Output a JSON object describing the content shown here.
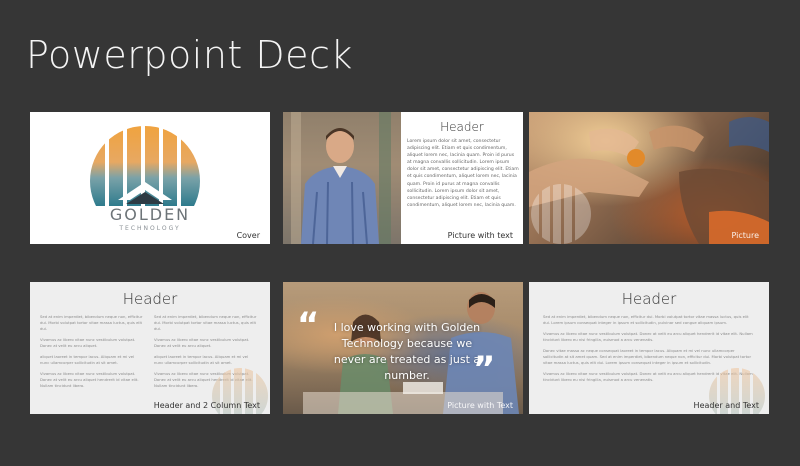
{
  "page_title": "Powerpoint Deck",
  "slides": [
    {
      "caption": "Cover",
      "brand_name": "GOLDEN",
      "brand_sub": "TECHNOLOGY"
    },
    {
      "caption": "Picture with text",
      "header": "Header",
      "body": "Lorem ipsum dolor sit amet, consectetur adipiscing elit. Etiam et quis condimentum, aliquet lorem nec, lacinia quam. Proin id purus at magna convallis sollicitudin. Lorem ipsum dolor sit amet, consectetur adipiscing elit. Etiam et quis condimentum, aliquet lorem nec, lacinia quam. Proin id purus at magna convallis sollicitudin. Lorem ipsum dolor sit amet, consectetur adipiscing elit. Etiam et quis condimentum, aliquet lorem nec, lacinia quam."
    },
    {
      "caption": "Picture"
    },
    {
      "caption": "Header and 2 Column Text",
      "header": "Header",
      "col1": [
        "Sed at enim imperdiet, bibendum neque non, efficitur dui. Morbi volutpat tortor vitae massa luctus, quis elit dui.",
        "Vivamus ac libero vitae nunc vestibulum volutpat. Donec at velit eu arcu aliquet.",
        "aliquet laoreet in tempor lacus. Aliquam et mi vel nunc ullamcorper sollicitudin at sit amet.",
        "Vivamus ac libero vitae nunc vestibulum volutpat. Donec at velit eu arcu aliquet hendrerit id vitae elit. Nullam tincidunt libero."
      ],
      "col2": [
        "Sed at enim imperdiet, bibendum neque non, efficitur dui. Morbi volutpat tortor vitae massa luctus, quis elit dui.",
        "Vivamus ac libero vitae nunc vestibulum volutpat. Donec at velit eu arcu aliquet.",
        "aliquet laoreet in tempor lacus. Aliquam et mi vel nunc ullamcorper sollicitudin at sit amet.",
        "Vivamus ac libero vitae nunc vestibulum volutpat. Donec at velit eu arcu aliquet hendrerit id vitae elit. Nullam tincidunt libero."
      ]
    },
    {
      "caption": "Picture with Text",
      "quote": "I love working with Golden Technology because we never are treated as just a number.",
      "open_quote": "“",
      "close_quote": "”"
    },
    {
      "caption": "Header and Text",
      "header": "Header",
      "paragraphs": [
        "Sed at enim imperdiet, bibendum neque non, efficitur dui. Morbi volutpat tortor vitae massa luctus, quis elit dui. Lorem ipsum consequat integer in ipsum et sollicitudin, pulvinar sed congue aliquam ipsum.",
        "Vivamus ac libero vitae nunc vestibulum volutpat. Donec at velit eu arcu aliquet hendrerit id vitae elit. Nullam tincidunt libero eu nisi fringilla, euismod a arcu venenatis.",
        "Donec vitae massa ac neque consequat laoreet in tempor lacus. Aliquam et mi vel nunc ullamcorper sollicitudin at sit amet quam. Sed at enim imperdiet, bibendum neque non, efficitur dui. Morbi volutpat tortor vitae massa luctus, quis elit dui. Lorem ipsum consequat integer in ipsum et sollicitudin.",
        "Vivamus ac libero vitae nunc vestibulum volutpat. Donec at velit eu arcu aliquet hendrerit id vitae elit. Nullam tincidunt libero eu nisi fringilla, euismod a arcu venenatis."
      ]
    }
  ]
}
